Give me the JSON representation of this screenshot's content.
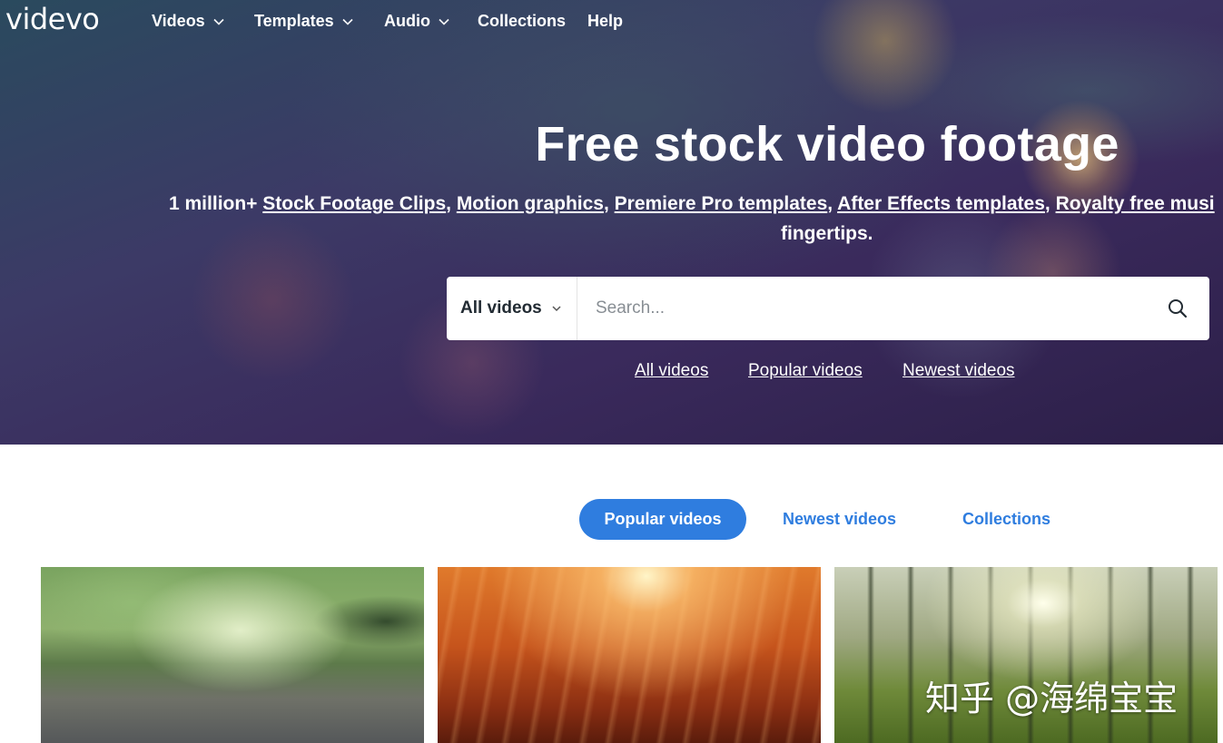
{
  "brand": {
    "logo": "videvo"
  },
  "nav": {
    "items": [
      {
        "label": "Videos",
        "has_dropdown": true
      },
      {
        "label": "Templates",
        "has_dropdown": true
      },
      {
        "label": "Audio",
        "has_dropdown": true
      },
      {
        "label": "Collections",
        "has_dropdown": false
      },
      {
        "label": "Help",
        "has_dropdown": false
      }
    ]
  },
  "hero": {
    "title": "Free stock video footage",
    "subtitle_prefix": "1 million+ ",
    "subtitle_links": [
      "Stock Footage Clips",
      "Motion graphics",
      "Premiere Pro templates",
      "After Effects templates",
      "Royalty free musi"
    ],
    "subtitle_sep": ", ",
    "subtitle_line2": "fingertips."
  },
  "search": {
    "category": "All videos",
    "placeholder": "Search...",
    "icon": "search-icon"
  },
  "quick_links": [
    "All videos",
    "Popular videos",
    "Newest videos"
  ],
  "tabs": {
    "active": "Popular videos",
    "others": [
      "Newest videos",
      "Collections"
    ]
  },
  "watermark": "知乎 @海绵宝宝",
  "colors": {
    "accent": "#2f7ddf",
    "hero_bg": "#3a2a5c",
    "text_light": "#ffffff"
  }
}
